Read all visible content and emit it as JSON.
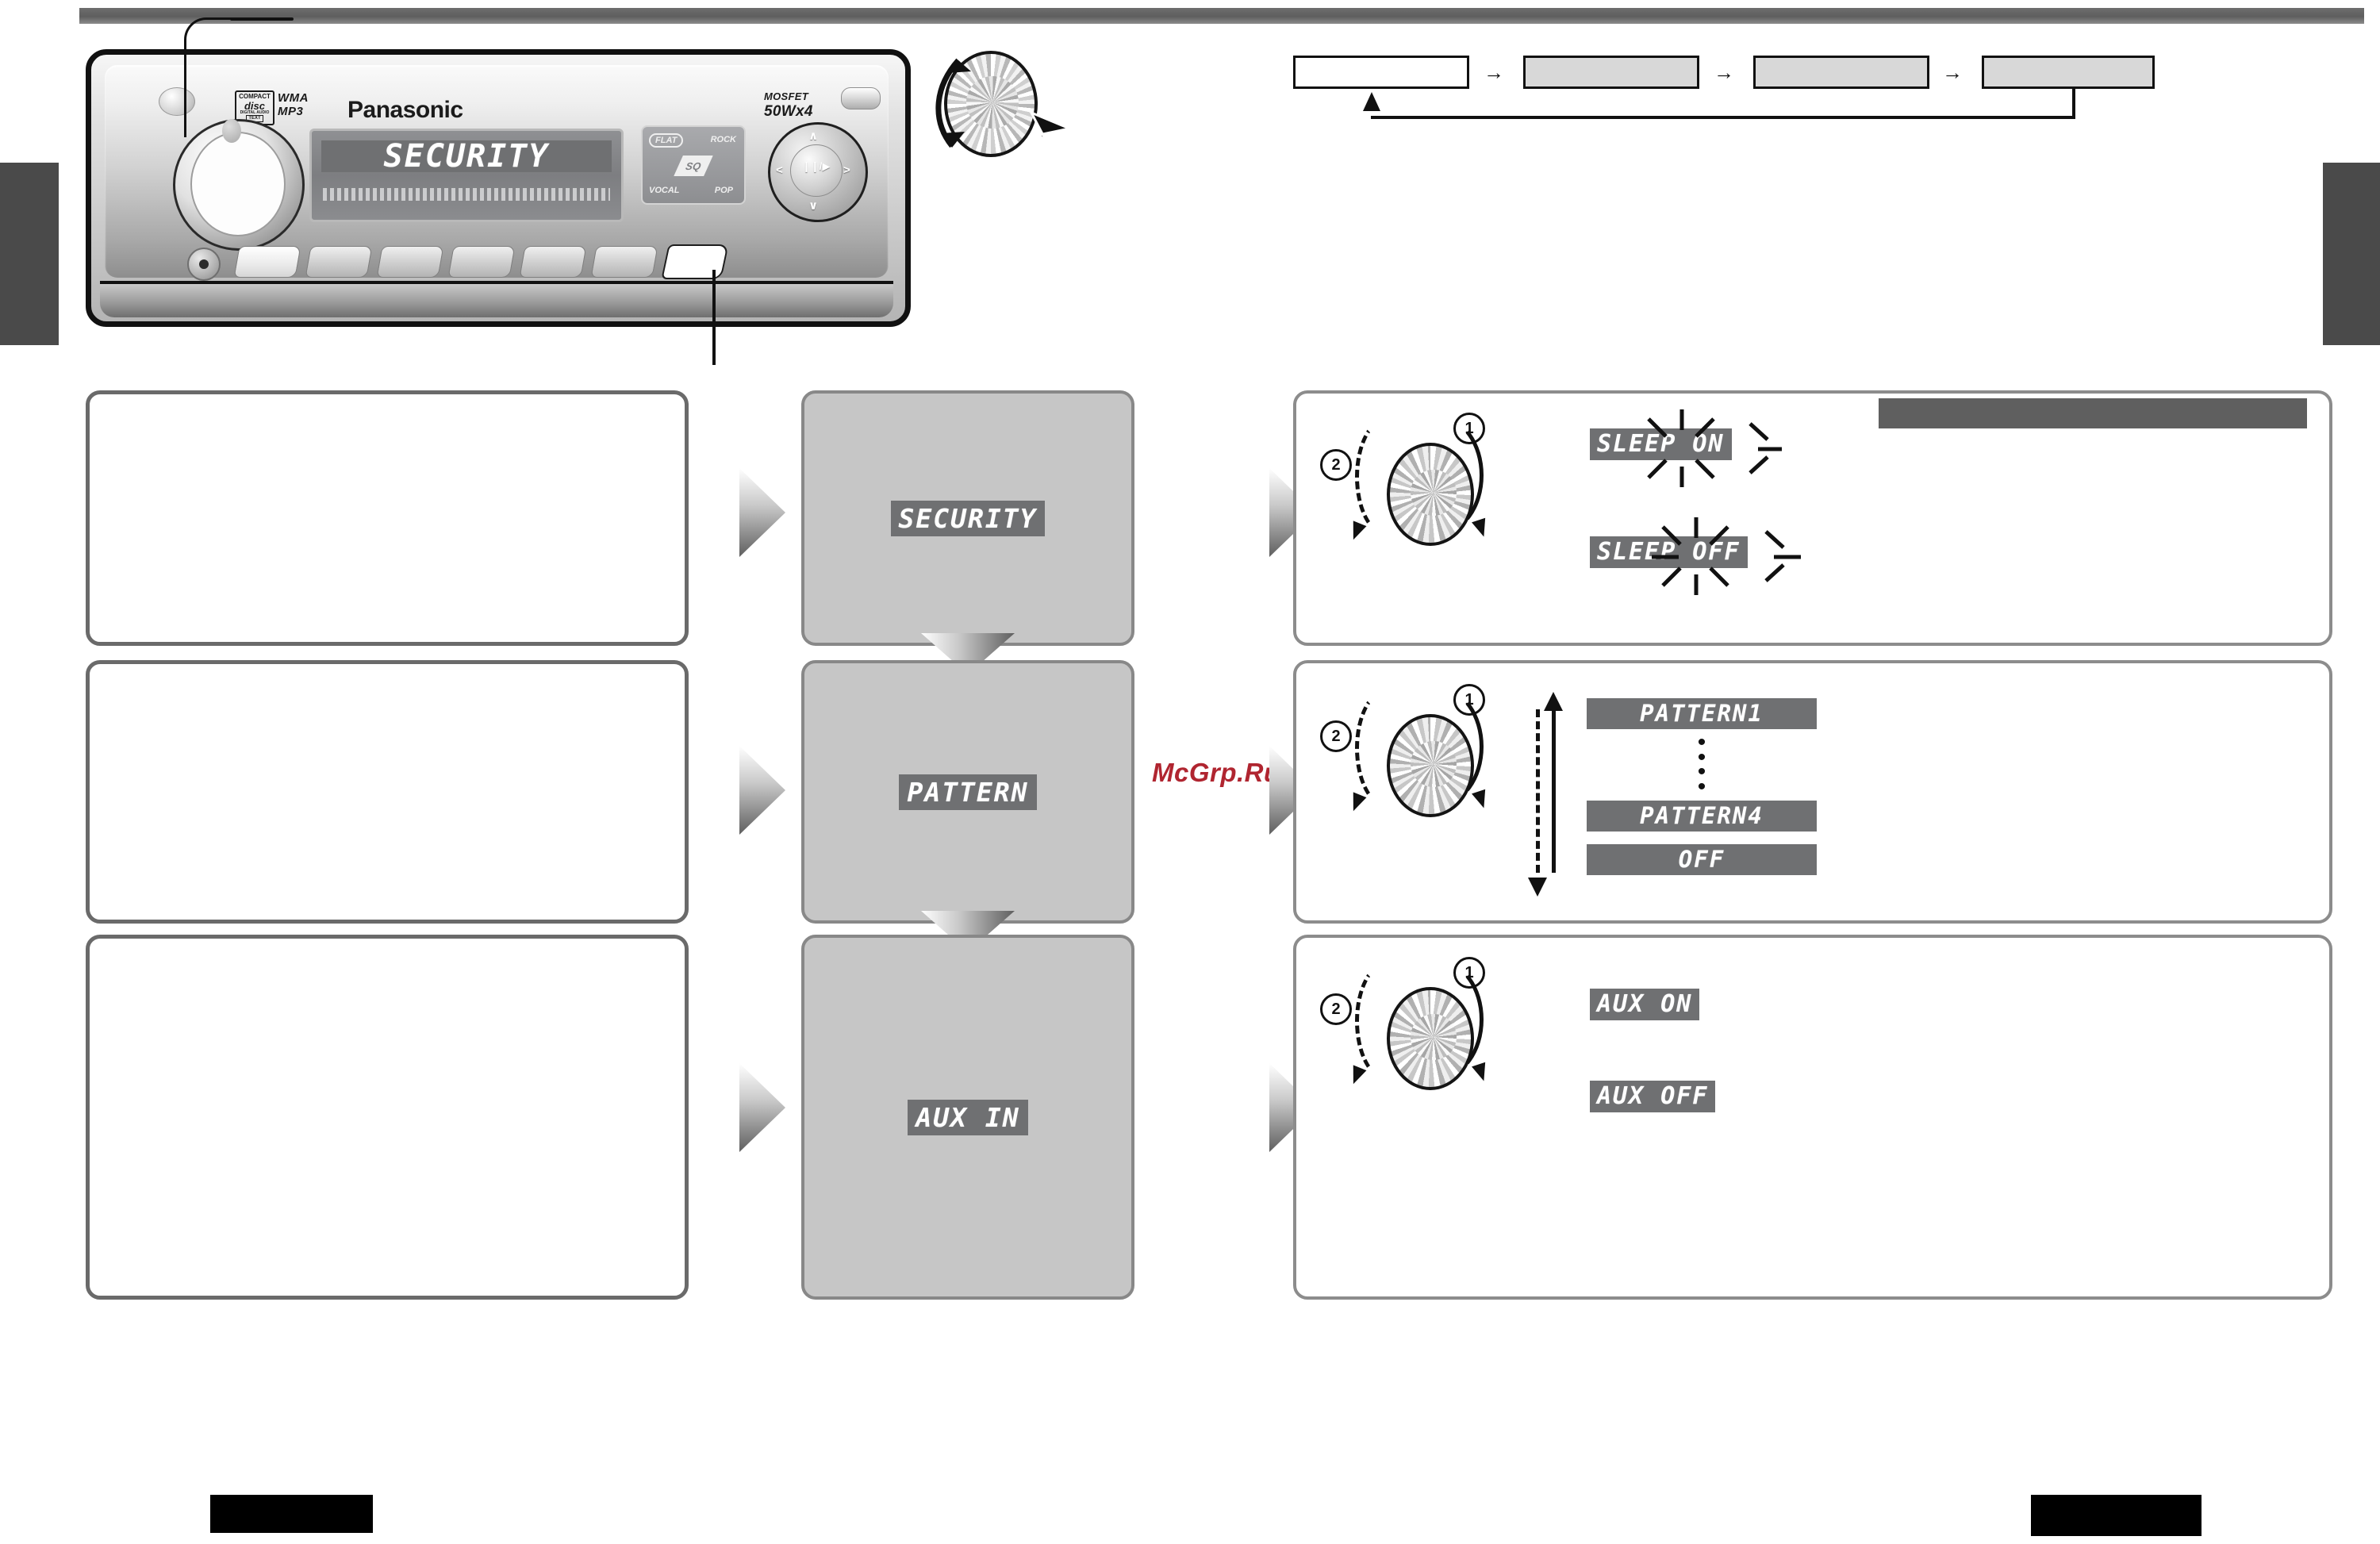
{
  "document": {
    "type": "car-audio-owners-manual-page",
    "watermark": "McGrp.Ru"
  },
  "head_unit": {
    "brand": "Panasonic",
    "cd_logo": {
      "line1": "COMPACT",
      "line2": "disc",
      "line3": "DIGITAL AUDIO",
      "line4": "TEXT"
    },
    "format_badges": {
      "wma": "WMA",
      "mp3": "MP3"
    },
    "power_badge": {
      "line1": "MOSFET",
      "line2": "50Wx4"
    },
    "display_text": "SECURITY",
    "eq_labels": {
      "flat": "FLAT",
      "rock": "ROCK",
      "sq": "SQ",
      "vocal": "VOCAL",
      "pop": "POP"
    },
    "nav_glyphs": {
      "up": "∧",
      "down": "∨",
      "left": "<",
      "right": ">",
      "play": "❙❙/▶",
      "prev": "◀◀",
      "next": "▶▶"
    }
  },
  "flow_diagram": {
    "boxes": [
      {
        "label": "",
        "style": "white"
      },
      {
        "label": "",
        "style": "gray"
      },
      {
        "label": "",
        "style": "gray"
      },
      {
        "label": "",
        "style": "gray"
      }
    ],
    "arrow_glyph": "→",
    "loop_back": true
  },
  "rows": [
    {
      "id": "security",
      "description": "",
      "display_label": "SECURITY",
      "step_numbers": {
        "first": "1",
        "second": "2"
      },
      "readouts": [
        {
          "text": "SLEEP ON",
          "blinking": true
        },
        {
          "text": "SLEEP OFF",
          "blinking": true
        }
      ],
      "note_redacted": true
    },
    {
      "id": "pattern",
      "description": "",
      "display_label": "PATTERN",
      "step_numbers": {
        "first": "1",
        "second": "2"
      },
      "options": [
        {
          "text": "PATTERN1"
        },
        {
          "text": "⋮"
        },
        {
          "text": "PATTERN4"
        },
        {
          "text": "OFF"
        }
      ],
      "range_arrow": "bidirectional-vertical"
    },
    {
      "id": "aux-in",
      "description": "",
      "display_label": "AUX IN",
      "step_numbers": {
        "first": "1",
        "second": "2"
      },
      "readouts": [
        {
          "text": "AUX ON",
          "blinking": false
        },
        {
          "text": "AUX OFF",
          "blinking": false
        }
      ]
    }
  ],
  "footer": {
    "left_bar_redacted": true,
    "right_bar_redacted": true
  }
}
